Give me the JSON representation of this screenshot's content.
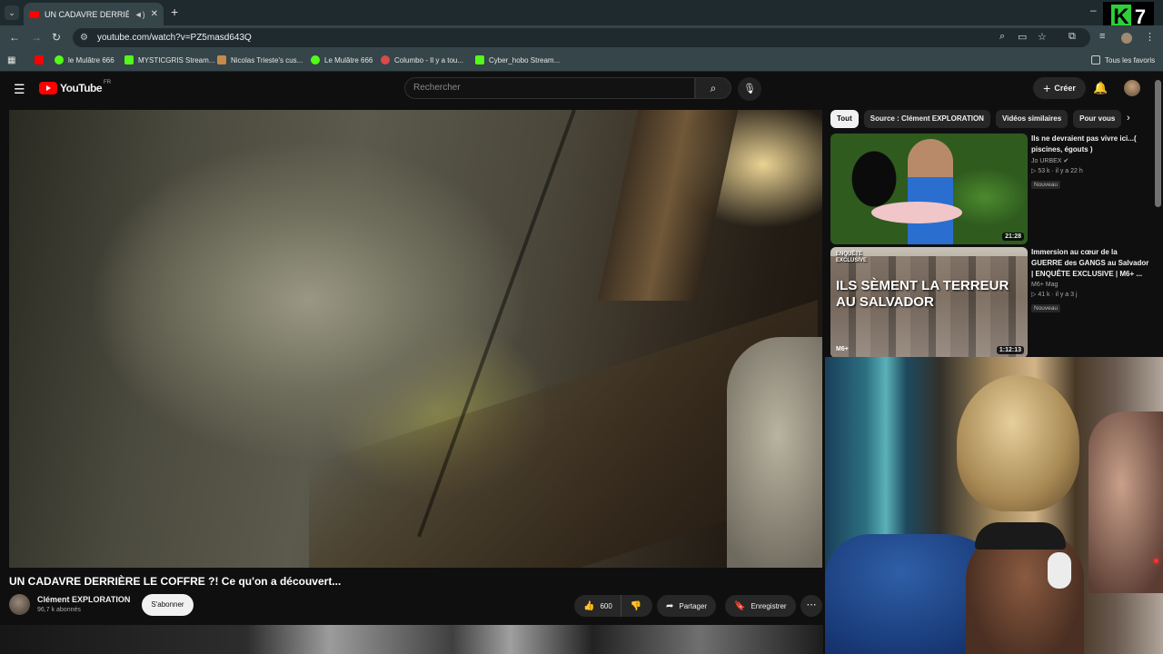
{
  "browser": {
    "tab_title": "UN CADAVRE DERRIÈRE LE",
    "url": "youtube.com/watch?v=PZ5masd643Q",
    "bookmarks": [
      {
        "label": "le Mulâtre 666",
        "icon": "play-icon"
      },
      {
        "label": "MYSTICGRIS Stream...",
        "icon": "kick-icon"
      },
      {
        "label": "Nicolas Trieste's cus...",
        "icon": "fox-icon"
      },
      {
        "label": "Le Mulâtre 666",
        "icon": "play-icon"
      },
      {
        "label": "Columbo - Il y a tou...",
        "icon": "red-circle-icon"
      },
      {
        "label": "Cyber_hobo Stream...",
        "icon": "kick-icon"
      }
    ],
    "all_bookmarks": "Tous les favoris"
  },
  "overlay": {
    "logo_k": "K",
    "logo_7": "7"
  },
  "youtube": {
    "logo_text": "YouTube",
    "logo_region": "FR",
    "search_placeholder": "Rechercher",
    "create_label": "Créer"
  },
  "video": {
    "title": "UN CADAVRE DERRIÈRE LE COFFRE ?! Ce qu'on a découvert...",
    "channel": "Clément EXPLORATION",
    "subscribers": "96,7 k abonnés",
    "subscribe_label": "S'abonner",
    "likes": "600",
    "share_label": "Partager",
    "save_label": "Enregistrer"
  },
  "chips": [
    "Tout",
    "Source : Clément EXPLORATION",
    "Vidéos similaires",
    "Pour vous"
  ],
  "recommendations": [
    {
      "title": "Ils ne devraient pas vivre ici...( piscines, égouts )",
      "channel": "Jo URBEX",
      "verified": "✔",
      "meta": "▷ 53 k · il y a 22 h",
      "badge": "Nouveau",
      "duration": "21:28"
    },
    {
      "title": "Immersion au cœur de la GUERRE des GANGS au Salvador | ENQUÊTE EXCLUSIVE | M6+ ...",
      "channel": "M6+ Mag",
      "meta": "▷ 41 k · il y a 3 j",
      "badge": "Nouveau",
      "duration": "1:12:13",
      "thumb_tag": "ENQUÊTE EXCLUSIVE",
      "thumb_text": "ILS SÈMENT LA TERREUR AU SALVADOR",
      "thumb_logo": "M6+"
    }
  ]
}
